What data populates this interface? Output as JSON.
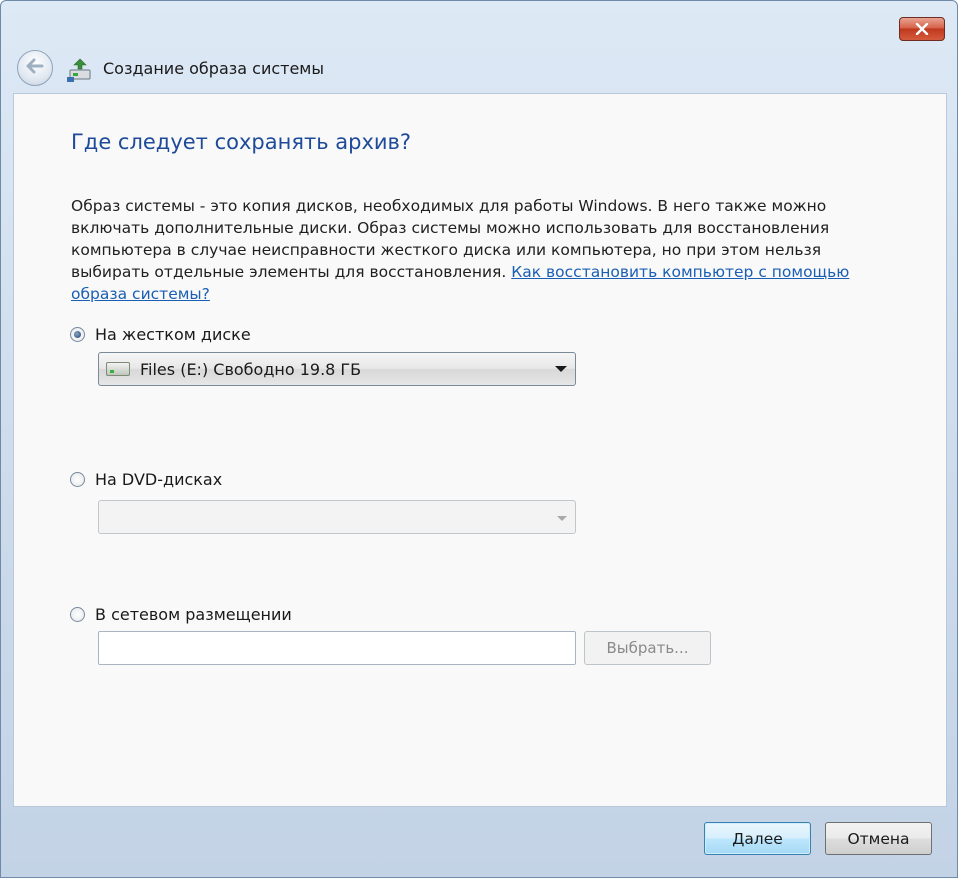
{
  "window": {
    "title": "Создание образа системы"
  },
  "icons": {
    "close": "close-icon",
    "back": "back-arrow-icon",
    "app": "system-image-backup-icon",
    "drive": "hard-drive-icon",
    "dropdown": "chevron-down-icon"
  },
  "main": {
    "heading": "Где следует сохранять архив?",
    "description": "Образ системы - это копия дисков, необходимых для работы Windows. В него также можно включать дополнительные диски. Образ системы можно использовать для восстановления компьютера в случае неисправности жесткого диска или компьютера, но при этом нельзя выбирать отдельные элементы для восстановления. ",
    "help_link": "Как восстановить компьютер с помощью образа системы?"
  },
  "options": {
    "hard_disk": {
      "label": "На жестком диске",
      "selected": true,
      "drive_value": "Files (E:)  Свободно 19.8 ГБ"
    },
    "dvd": {
      "label": "На DVD-дисках",
      "selected": false,
      "value": ""
    },
    "network": {
      "label": "В сетевом размещении",
      "selected": false,
      "path_value": "",
      "browse_label": "Выбрать..."
    }
  },
  "footer": {
    "next_label": "Далее",
    "cancel_label": "Отмена"
  },
  "colors": {
    "heading": "#1e4a9a",
    "link": "#1a5fb4",
    "close_button": "#c0381f",
    "primary_button_border": "#3c7fb1"
  }
}
